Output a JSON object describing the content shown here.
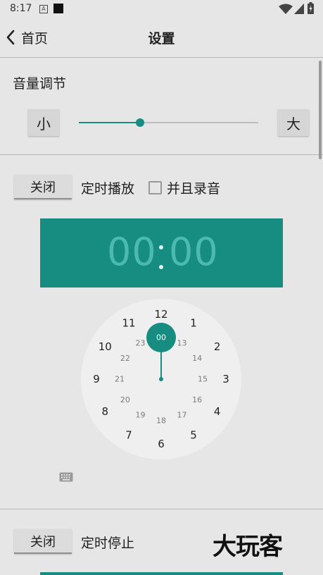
{
  "status_bar": {
    "time": "8:17",
    "icon_a": "A"
  },
  "toolbar": {
    "back_label": "首页",
    "title": "设置"
  },
  "volume": {
    "title": "音量调节",
    "min_label": "小",
    "max_label": "大",
    "level": 0.34
  },
  "timer_play": {
    "toggle_label": "关闭",
    "label": "定时播放",
    "record_label": "并且录音",
    "record_checked": false,
    "minutes": "00",
    "seconds": "00"
  },
  "clock": {
    "selected": "00",
    "outer": [
      "12",
      "1",
      "2",
      "3",
      "4",
      "5",
      "6",
      "7",
      "8",
      "9",
      "10",
      "11"
    ],
    "inner": [
      "00",
      "13",
      "14",
      "15",
      "16",
      "17",
      "18",
      "19",
      "20",
      "21",
      "22",
      "23"
    ]
  },
  "timer_stop": {
    "toggle_label": "关闭",
    "label": "定时停止"
  },
  "watermark": "大玩客",
  "colors": {
    "accent": "#168d80",
    "digits": "#4dbab0",
    "background": "#e6e6e6",
    "dial": "#efefef"
  },
  "icons": {
    "back": "chevron-left-icon",
    "keyboard": "keyboard-icon",
    "wifi": "wifi-icon",
    "signal": "signal-icon",
    "battery": "battery-icon"
  }
}
